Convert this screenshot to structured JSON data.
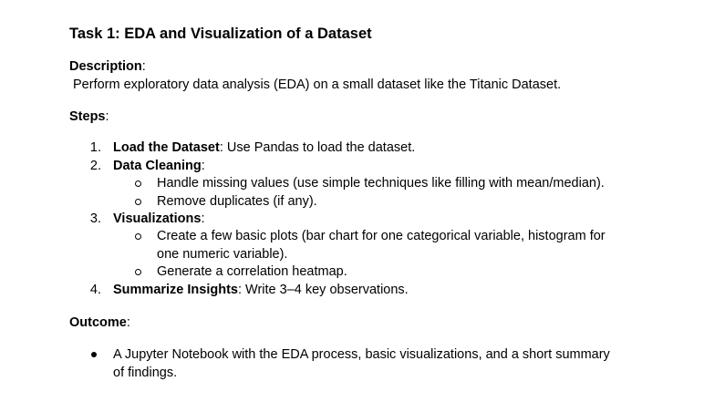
{
  "title": "Task 1: EDA and Visualization of a Dataset",
  "description": {
    "heading": "Description",
    "colon": ":",
    "text": "Perform exploratory data analysis (EDA) on a small dataset like the Titanic Dataset."
  },
  "steps": {
    "heading": "Steps",
    "colon": ":",
    "items": [
      {
        "number": "1.",
        "bold": "Load the Dataset",
        "rest": ": Use Pandas to load the dataset."
      },
      {
        "number": "2.",
        "bold": "Data Cleaning",
        "rest": ":",
        "subitems": [
          "Handle missing values (use simple techniques like filling with mean/median).",
          "Remove duplicates (if any)."
        ]
      },
      {
        "number": "3.",
        "bold": "Visualizations",
        "rest": ":",
        "subitems": [
          {
            "line1": "Create a few basic plots (bar chart for one categorical variable, histogram for",
            "line2": "one numeric variable)."
          },
          "Generate a correlation heatmap."
        ]
      },
      {
        "number": "4.",
        "bold": "Summarize Insights",
        "rest": ": Write 3–4 key observations."
      }
    ]
  },
  "outcome": {
    "heading": "Outcome",
    "colon": ":",
    "bullet": {
      "line1": "A Jupyter Notebook with the EDA process, basic visualizations, and a short summary",
      "line2": "of findings."
    }
  }
}
